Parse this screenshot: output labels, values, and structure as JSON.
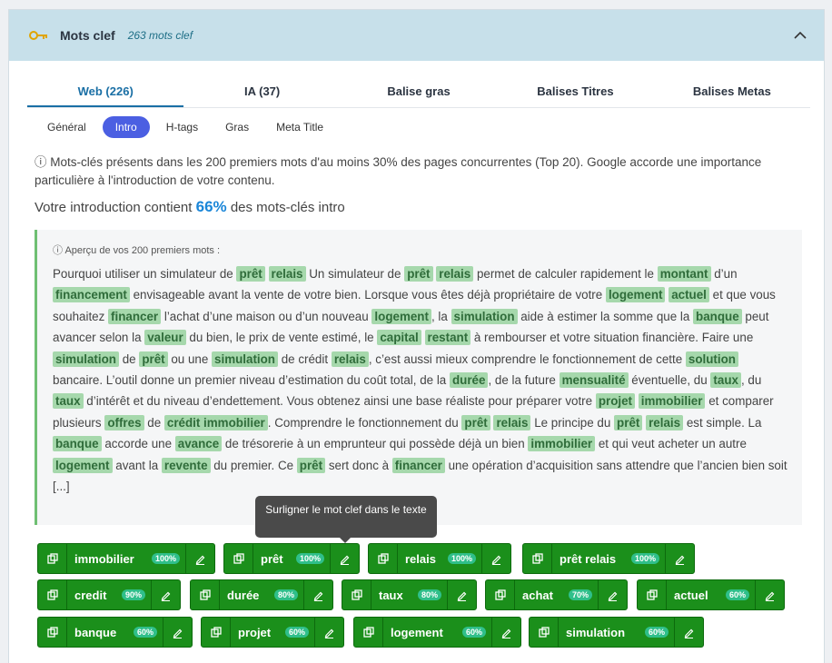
{
  "header": {
    "title": "Mots clef",
    "count": "263 mots clef",
    "icon": "key-icon",
    "collapse_icon": "chevron-up-icon"
  },
  "tabs": [
    {
      "label": "Web (226)",
      "active": true
    },
    {
      "label": "IA (37)"
    },
    {
      "label": "Balise gras"
    },
    {
      "label": "Balises Titres"
    },
    {
      "label": "Balises Metas"
    }
  ],
  "subtabs": [
    "Général",
    "Intro",
    "H-tags",
    "Gras",
    "Meta Title"
  ],
  "subtab_active": "Intro",
  "info": "ⓘ Mots-clés présents dans les 200 premiers mots d'au moins 30% des pages concurrentes (Top 20). Google accorde une importance particulière à l'introduction de votre contenu.",
  "summary": {
    "before": "Votre introduction contient ",
    "pct": "66%",
    "after": " des mots-clés intro"
  },
  "excerpt": {
    "title": "ⓘ Aperçu de vos 200 premiers mots :",
    "segments": [
      [
        "t",
        "Pourquoi utiliser un simulateur de "
      ],
      [
        "k",
        "prêt"
      ],
      [
        "t",
        " "
      ],
      [
        "k",
        "relais"
      ],
      [
        "t",
        " Un simulateur de "
      ],
      [
        "k",
        "prêt"
      ],
      [
        "t",
        " "
      ],
      [
        "k",
        "relais"
      ],
      [
        "t",
        " permet de calculer rapidement le "
      ],
      [
        "k",
        "montant"
      ],
      [
        "t",
        " d’un "
      ],
      [
        "k",
        "financement"
      ],
      [
        "t",
        " envisageable avant la vente de votre bien. Lorsque vous êtes déjà propriétaire de votre "
      ],
      [
        "k",
        "logement"
      ],
      [
        "t",
        " "
      ],
      [
        "k",
        "actuel"
      ],
      [
        "t",
        " et que vous souhaitez "
      ],
      [
        "k",
        "financer"
      ],
      [
        "t",
        " l’achat d’une maison ou d’un nouveau "
      ],
      [
        "k",
        "logement"
      ],
      [
        "t",
        ", la "
      ],
      [
        "k",
        "simulation"
      ],
      [
        "t",
        " aide à estimer la somme que la "
      ],
      [
        "k",
        "banque"
      ],
      [
        "t",
        " peut avancer selon la "
      ],
      [
        "k",
        "valeur"
      ],
      [
        "t",
        " du bien, le prix de vente estimé, le "
      ],
      [
        "k",
        "capital"
      ],
      [
        "t",
        " "
      ],
      [
        "k",
        "restant"
      ],
      [
        "t",
        " à rembourser et votre situation financière. Faire une "
      ],
      [
        "k",
        "simulation"
      ],
      [
        "t",
        " de "
      ],
      [
        "k",
        "prêt"
      ],
      [
        "t",
        " ou une "
      ],
      [
        "k",
        "simulation"
      ],
      [
        "t",
        " de crédit "
      ],
      [
        "k",
        "relais"
      ],
      [
        "t",
        ", c’est aussi mieux comprendre le fonctionnement de cette "
      ],
      [
        "k",
        "solution"
      ],
      [
        "t",
        " bancaire. L’outil donne un premier niveau d’estimation du coût total, de la "
      ],
      [
        "k",
        "durée"
      ],
      [
        "t",
        ", de la future "
      ],
      [
        "k",
        "mensualité"
      ],
      [
        "t",
        " éventuelle, du "
      ],
      [
        "k",
        "taux"
      ],
      [
        "t",
        ", du "
      ],
      [
        "k",
        "taux"
      ],
      [
        "t",
        " d’intérêt et du niveau d’endettement. Vous obtenez ainsi une base réaliste pour préparer votre "
      ],
      [
        "k",
        "projet"
      ],
      [
        "t",
        " "
      ],
      [
        "k",
        "immobilier"
      ],
      [
        "t",
        " et comparer plusieurs "
      ],
      [
        "k",
        "offres"
      ],
      [
        "t",
        " de "
      ],
      [
        "k",
        "crédit immobilier"
      ],
      [
        "t",
        ". Comprendre le fonctionnement du "
      ],
      [
        "k",
        "prêt"
      ],
      [
        "t",
        " "
      ],
      [
        "k",
        "relais"
      ],
      [
        "t",
        " Le principe du "
      ],
      [
        "k",
        "prêt"
      ],
      [
        "t",
        " "
      ],
      [
        "k",
        "relais"
      ],
      [
        "t",
        " est simple. La "
      ],
      [
        "k",
        "banque"
      ],
      [
        "t",
        " accorde une "
      ],
      [
        "k",
        "avance"
      ],
      [
        "t",
        " de trésorerie à un emprunteur qui possède déjà un bien "
      ],
      [
        "k",
        "immobilier"
      ],
      [
        "t",
        " et qui veut acheter un autre "
      ],
      [
        "k",
        "logement"
      ],
      [
        "t",
        " avant la "
      ],
      [
        "k",
        "revente"
      ],
      [
        "t",
        " du premier. Ce "
      ],
      [
        "k",
        "prêt"
      ],
      [
        "t",
        " sert donc à "
      ],
      [
        "k",
        "financer"
      ],
      [
        "t",
        " une opération d’acquisition sans attendre que l’ancien bien soit [...]"
      ]
    ]
  },
  "tooltip": "Surligner le mot clef dans le texte",
  "chips": [
    {
      "label": "immobilier",
      "pct": "100%"
    },
    {
      "label": "prêt",
      "pct": "100%"
    },
    {
      "label": "relais",
      "pct": "100%"
    },
    {
      "label": "prêt relais",
      "pct": "100%"
    },
    {
      "label": "credit",
      "pct": "90%"
    },
    {
      "label": "durée",
      "pct": "80%"
    },
    {
      "label": "taux",
      "pct": "80%"
    },
    {
      "label": "achat",
      "pct": "70%"
    },
    {
      "label": "actuel",
      "pct": "60%"
    },
    {
      "label": "banque",
      "pct": "60%"
    },
    {
      "label": "projet",
      "pct": "60%"
    },
    {
      "label": "logement",
      "pct": "60%"
    },
    {
      "label": "simulation",
      "pct": "60%"
    }
  ]
}
